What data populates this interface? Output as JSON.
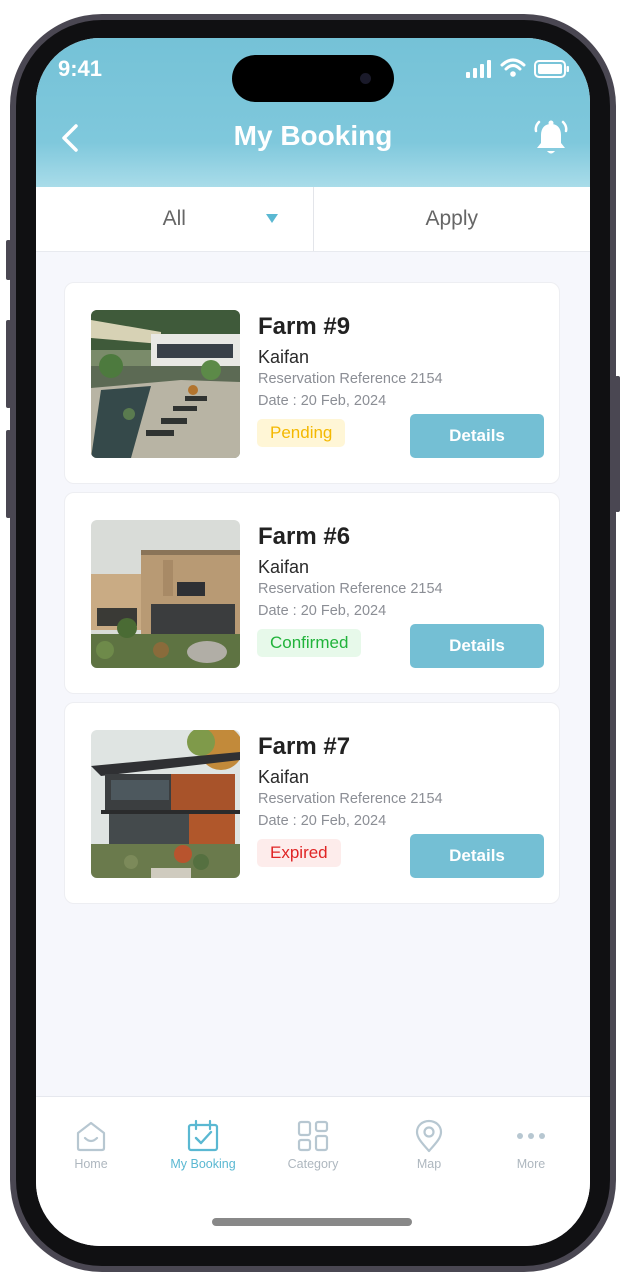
{
  "status": {
    "time": "9:41"
  },
  "header": {
    "title": "My Booking",
    "back_icon": "chevron-left-icon",
    "bell_icon": "bell-ring-icon"
  },
  "filter": {
    "selected": "All",
    "apply_label": "Apply"
  },
  "bookings": [
    {
      "title": "Farm #9",
      "owner": "Kaifan",
      "reference": "Reservation Reference 2154",
      "date": "Date : 20 Feb, 2024",
      "status": "Pending",
      "status_color": "#f4b800",
      "status_bg": "#fff6d6",
      "details_label": "Details"
    },
    {
      "title": "Farm #6",
      "owner": "Kaifan",
      "reference": "Reservation Reference 2154",
      "date": "Date : 20 Feb, 2024",
      "status": "Confirmed",
      "status_color": "#21b33b",
      "status_bg": "#e7f9ea",
      "details_label": "Details"
    },
    {
      "title": "Farm #7",
      "owner": "Kaifan",
      "reference": "Reservation Reference 2154",
      "date": "Date : 20 Feb, 2024",
      "status": "Expired",
      "status_color": "#e02424",
      "status_bg": "#fdeceb",
      "details_label": "Details"
    }
  ],
  "nav": {
    "items": [
      {
        "label": "Home",
        "icon": "home-icon"
      },
      {
        "label": "My Booking",
        "icon": "calendar-check-icon",
        "active": true
      },
      {
        "label": "Category",
        "icon": "grid-icon"
      },
      {
        "label": "Map",
        "icon": "map-pin-icon"
      },
      {
        "label": "More",
        "icon": "more-dots-icon"
      }
    ]
  },
  "colors": {
    "accent": "#74bfd4",
    "header_top": "#75c2d7",
    "background": "#f6f7fc"
  }
}
